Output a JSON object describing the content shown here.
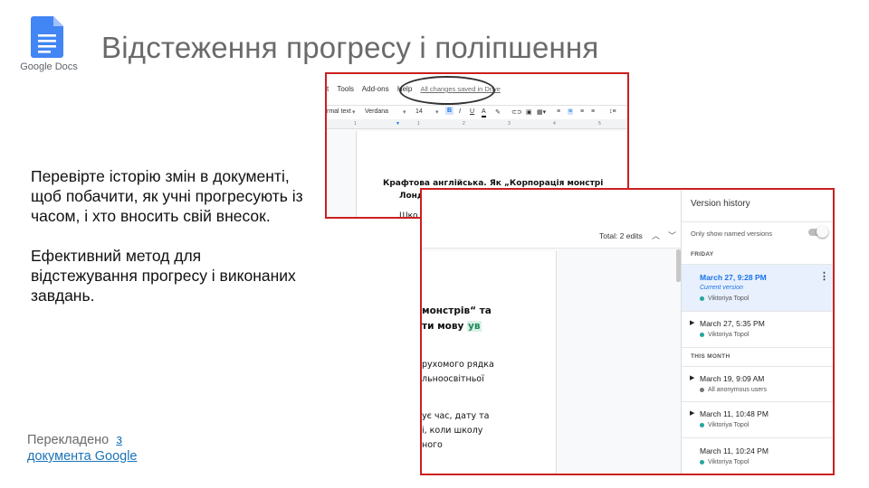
{
  "logo": {
    "caption": "Google Docs",
    "icon": "google-docs-icon",
    "color": "#4285f4"
  },
  "title": "Відстеження прогресу і поліпшення",
  "body": {
    "paragraph1": "Перевірте історію змін в документі, щоб побачити, як учні прогресують із часом, і хто вносить свій внесок.",
    "paragraph2": "Ефективний метод для відстежування прогресу і виконаних завдань."
  },
  "footer": {
    "prefix": "Перекладено",
    "link_part1": "з",
    "link_part2": "документа Google"
  },
  "screenshot1": {
    "menu": [
      "t",
      "Tools",
      "Add-ons",
      "Help"
    ],
    "saved_status": "All changes saved in Drive",
    "toolbar": {
      "style": "rmal text",
      "font": "Verdana",
      "size": "14",
      "bold": "B",
      "italic": "I",
      "underline": "U",
      "text_color": "A"
    },
    "ruler_marks": [
      "1",
      "1",
      "2",
      "3",
      "4",
      "5"
    ],
    "doc_lines": [
      "Крафтова англійська. Як „Корпорація монстрі",
      "Лонд",
      "Шко"
    ]
  },
  "screenshot2": {
    "total_edits": "Total: 2 edits",
    "doc_lines": [
      {
        "text": "монстрів“ та",
        "bold": true
      },
      {
        "text": "ти мову ",
        "bold": true,
        "highlight": "ув"
      },
      {
        "text": "рухомого рядка",
        "bold": false
      },
      {
        "text": "льноосвітньої",
        "bold": false
      },
      {
        "text": "ує час, дату та",
        "bold": false
      },
      {
        "text": "і, коли школу",
        "bold": false
      },
      {
        "text": "ного",
        "bold": false
      }
    ],
    "version_history": {
      "title": "Version history",
      "only_named": "Only show named versions",
      "groups": [
        {
          "label": "FRIDAY",
          "items": [
            {
              "date": "March 27, 9:28 PM",
              "current": "Current version",
              "user": "Viktoriya Topol",
              "dot_color": "#26a69a",
              "active": true,
              "expandable": false
            },
            {
              "date": "March 27, 5:35 PM",
              "user": "Viktoriya Topol",
              "dot_color": "#26a69a",
              "active": false,
              "expandable": true
            }
          ]
        },
        {
          "label": "THIS MONTH",
          "items": [
            {
              "date": "March 19, 9:09 AM",
              "user": "All anonymous users",
              "dot_color": "#757575",
              "active": false,
              "expandable": true
            },
            {
              "date": "March 11, 10:48 PM",
              "user": "Viktoriya Topol",
              "dot_color": "#26a69a",
              "active": false,
              "expandable": true
            },
            {
              "date": "March 11, 10:24 PM",
              "user": "Viktoriya Topol",
              "dot_color": "#26a69a",
              "active": false,
              "expandable": false
            }
          ]
        }
      ]
    }
  },
  "colors": {
    "frame": "#cc1f1f",
    "title": "#6a6a6a",
    "link": "#1a73b8",
    "active_version": "#1a73e8"
  }
}
